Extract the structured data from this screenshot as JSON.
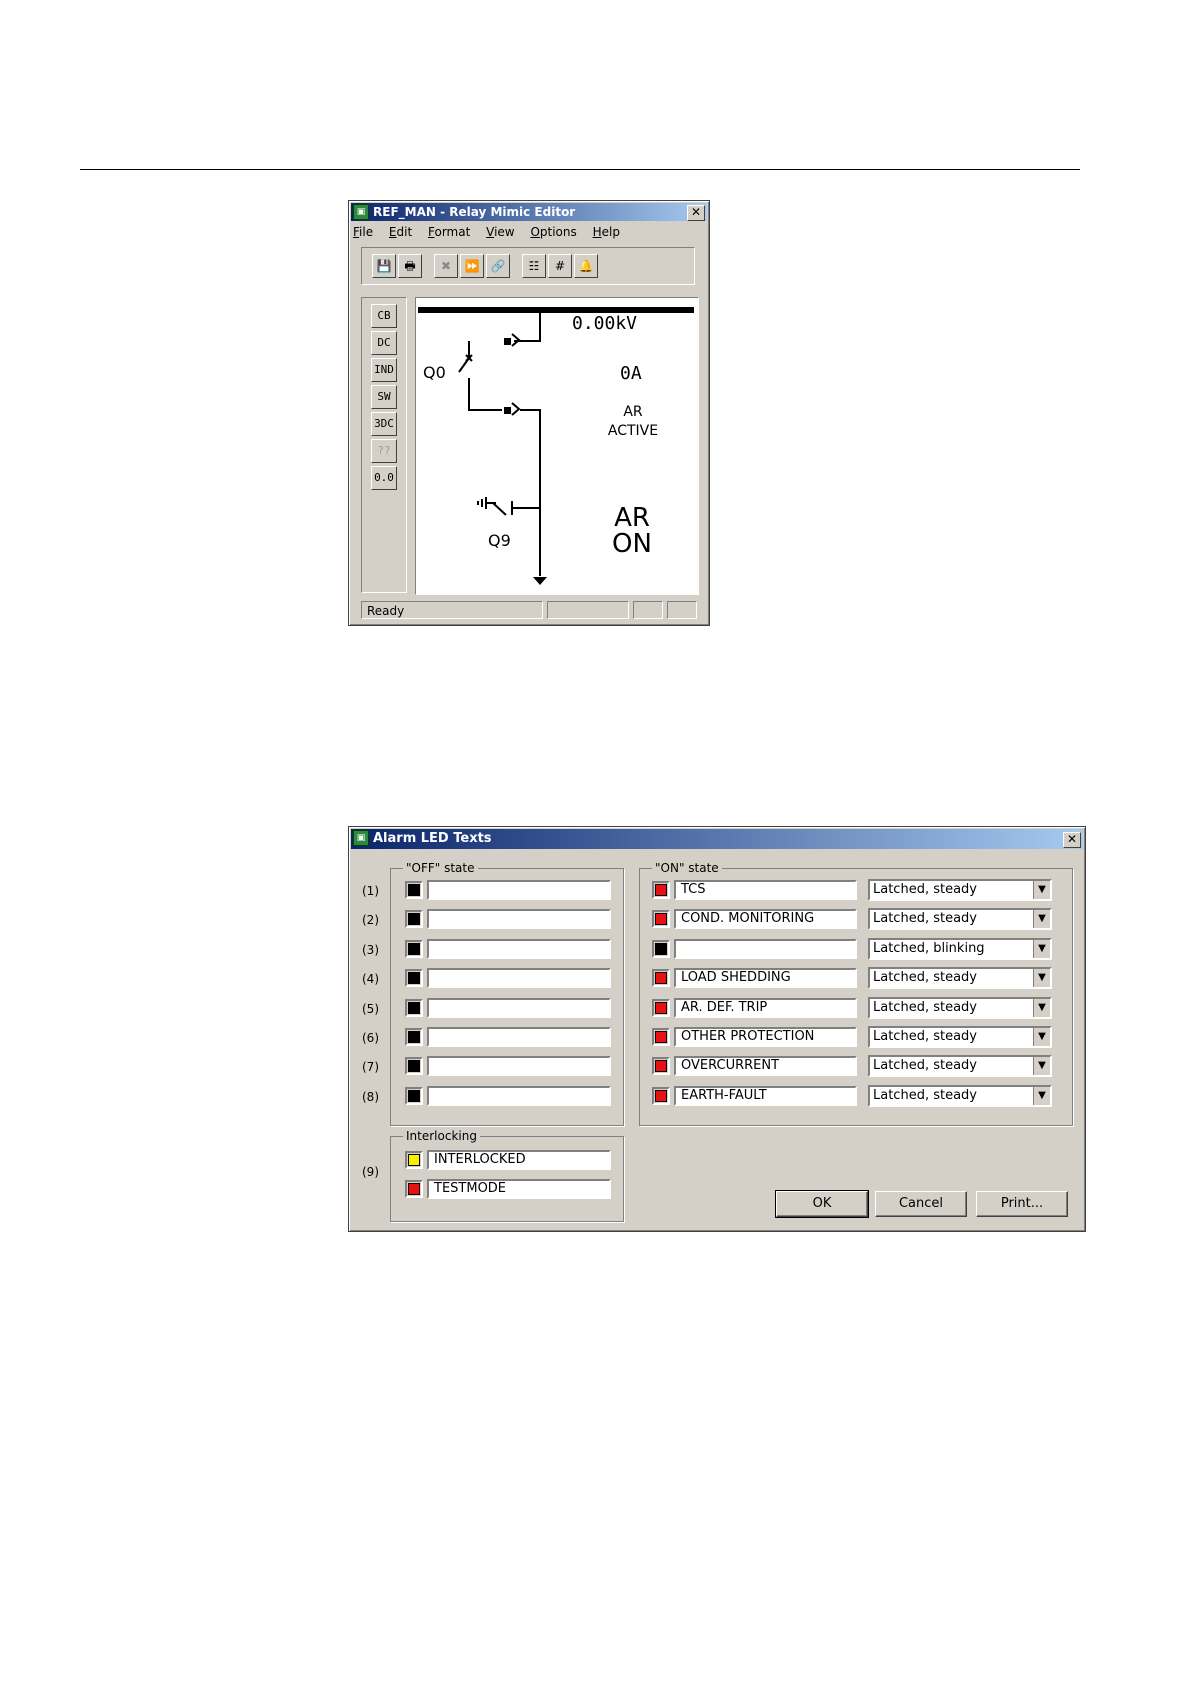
{
  "mimic_editor": {
    "title": "REF_MAN - Relay Mimic Editor",
    "close_glyph": "✕",
    "menu": [
      "File",
      "Edit",
      "Format",
      "View",
      "Options",
      "Help"
    ],
    "toolbar": [
      {
        "icon": "save-icon",
        "glyph": "💾"
      },
      {
        "icon": "print-icon",
        "glyph": "🖶"
      },
      {
        "icon": "tools-icon",
        "glyph": "✖"
      },
      {
        "icon": "forward-icon",
        "glyph": "⏩"
      },
      {
        "icon": "link-icon",
        "glyph": "🔗"
      },
      {
        "icon": "table-icon",
        "glyph": "☷"
      },
      {
        "icon": "grid-icon",
        "glyph": "#"
      },
      {
        "icon": "alarm-icon",
        "glyph": "🔔"
      }
    ],
    "palette": [
      "CB",
      "DC",
      "IND",
      "SW",
      "3DC",
      "??",
      "0.0"
    ],
    "diagram": {
      "voltage": "0.00kV",
      "current": "0A",
      "breaker_label": "Q0",
      "earth_switch_label": "Q9",
      "ar_status_line1": "AR",
      "ar_status_line2": "ACTIVE",
      "ar_big_line1": "AR",
      "ar_big_line2": "ON"
    },
    "status": "Ready"
  },
  "alarm_dialog": {
    "title": "Alarm LED Texts",
    "close_glyph": "✕",
    "off_group_title": "\"OFF\" state",
    "on_group_title": "\"ON\" state",
    "interlocking_title": "Interlocking",
    "colors": {
      "black": "#000000",
      "red": "#e81010",
      "yellow": "#f6f000"
    },
    "rows": [
      {
        "num": "(1)",
        "off_color": "black",
        "off_text": "",
        "on_color": "red",
        "on_text": "TCS",
        "mode": "Latched, steady"
      },
      {
        "num": "(2)",
        "off_color": "black",
        "off_text": "",
        "on_color": "red",
        "on_text": "COND. MONITORING",
        "mode": "Latched, steady"
      },
      {
        "num": "(3)",
        "off_color": "black",
        "off_text": "",
        "on_color": "black",
        "on_text": "",
        "mode": "Latched, blinking"
      },
      {
        "num": "(4)",
        "off_color": "black",
        "off_text": "",
        "on_color": "red",
        "on_text": "LOAD SHEDDING",
        "mode": "Latched, steady"
      },
      {
        "num": "(5)",
        "off_color": "black",
        "off_text": "",
        "on_color": "red",
        "on_text": "AR. DEF. TRIP",
        "mode": "Latched, steady"
      },
      {
        "num": "(6)",
        "off_color": "black",
        "off_text": "",
        "on_color": "red",
        "on_text": "OTHER PROTECTION",
        "mode": "Latched, steady"
      },
      {
        "num": "(7)",
        "off_color": "black",
        "off_text": "",
        "on_color": "red",
        "on_text": "OVERCURRENT",
        "mode": "Latched, steady"
      },
      {
        "num": "(8)",
        "off_color": "black",
        "off_text": "",
        "on_color": "red",
        "on_text": "EARTH-FAULT",
        "mode": "Latched, steady"
      }
    ],
    "interlock_row_num": "(9)",
    "interlock": [
      {
        "color": "yellow",
        "text": "INTERLOCKED"
      },
      {
        "color": "red",
        "text": "TESTMODE"
      }
    ],
    "buttons": {
      "ok": "OK",
      "cancel": "Cancel",
      "print": "Print..."
    }
  }
}
